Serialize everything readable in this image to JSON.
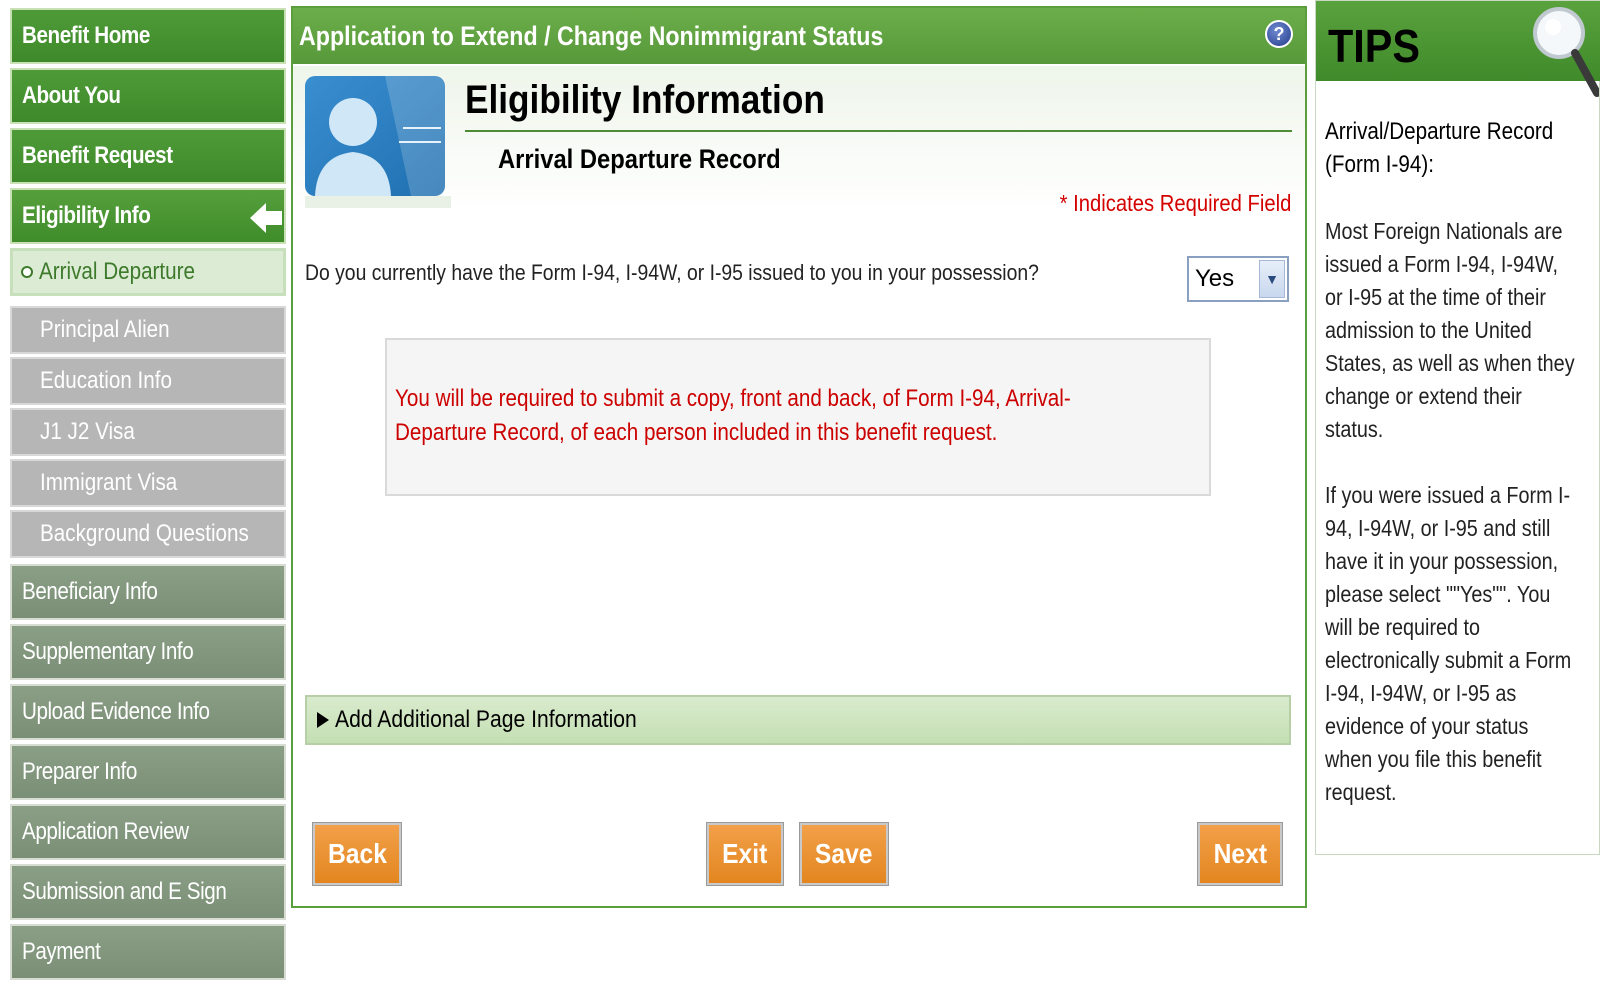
{
  "sidebar": {
    "items": [
      {
        "label": "Benefit Home",
        "state": "done"
      },
      {
        "label": "About You",
        "state": "done"
      },
      {
        "label": "Benefit Request",
        "state": "done"
      },
      {
        "label": "Eligibility Info",
        "state": "active"
      }
    ],
    "subitems": [
      {
        "label": "Arrival Departure",
        "state": "current"
      },
      {
        "label": "Principal Alien",
        "state": "pending"
      },
      {
        "label": "Education Info",
        "state": "pending"
      },
      {
        "label": "J1 J2 Visa",
        "state": "pending"
      },
      {
        "label": "Immigrant Visa",
        "state": "pending"
      },
      {
        "label": "Background Questions",
        "state": "pending"
      }
    ],
    "future_items": [
      {
        "label": "Beneficiary Info"
      },
      {
        "label": "Supplementary Info"
      },
      {
        "label": "Upload Evidence Info"
      },
      {
        "label": "Preparer Info"
      },
      {
        "label": "Application Review"
      },
      {
        "label": "Submission and E Sign"
      },
      {
        "label": "Payment"
      }
    ]
  },
  "main": {
    "header_title": "Application to Extend / Change Nonimmigrant Status",
    "help_glyph": "?",
    "section_title": "Eligibility Information",
    "section_subtitle": "Arrival Departure Record",
    "required_note": "* Indicates Required Field",
    "question": "Do you currently have the Form I-94, I-94W, or I-95 issued to you in your possession?",
    "answer_value": "Yes",
    "info_message": "You will be required to submit a copy, front and back, of Form I-94, Arrival-Departure Record, of each person included in this benefit request.",
    "additional_info_label": "Add Additional Page Information"
  },
  "buttons": {
    "back": "Back",
    "exit": "Exit",
    "save": "Save",
    "next": "Next"
  },
  "tips": {
    "title": "TIPS",
    "heading": "Arrival/Departure Record (Form I-94):",
    "paragraph1": "Most Foreign Nationals are issued a Form I-94, I-94W, or I-95 at the time of their admission to the United States, as well as when they change or extend their status.",
    "paragraph2": "If you were issued a Form I-94, I-94W, or I-95 and still have it in your possession, please select \"\"Yes\"\". You will be required to electronically submit a Form I-94, I-94W, or I-95 as evidence of your status when you file this benefit request."
  },
  "colors": {
    "brand_green": "#57993a",
    "button_orange": "#e3861f",
    "required_red": "#d40000",
    "pending_gray": "#b6b6b6",
    "future_gray": "#7a8f76"
  }
}
